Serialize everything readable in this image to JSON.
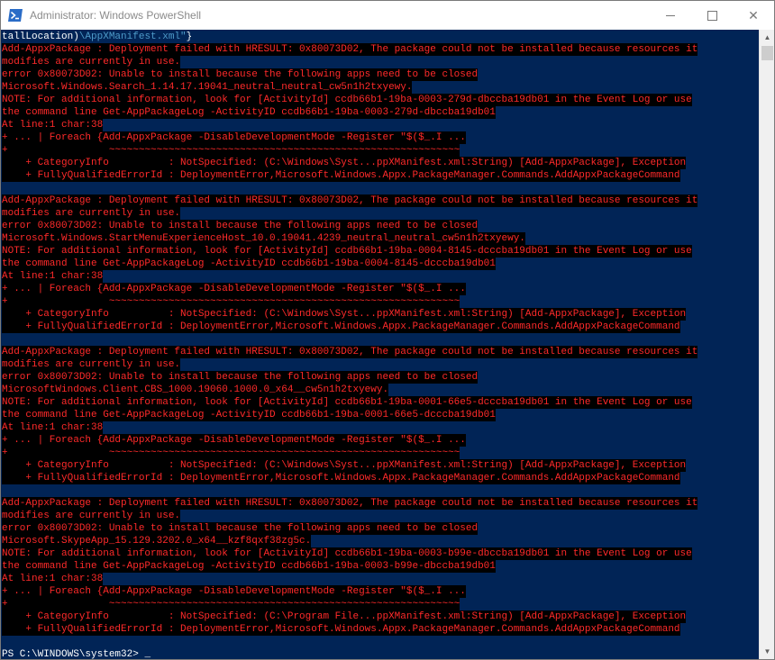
{
  "window": {
    "title": "Administrator: Windows PowerShell",
    "icon": "powershell-icon",
    "minimize_label": "",
    "maximize_label": "",
    "close_label": "✕"
  },
  "console": {
    "background": "#012456",
    "error_foreground": "#ff2a2a",
    "error_background": "#000000",
    "first_line": {
      "a": "tallLocation)",
      "b": "\\AppXManifest.xml\"",
      "c": "}"
    },
    "errors": [
      {
        "line1": "Add-AppxPackage : Deployment failed with HRESULT: 0x80073D02, The package could not be installed because resources it",
        "line2": "modifies are currently in use.",
        "line3": "error 0x80073D02: Unable to install because the following apps need to be closed",
        "line4": "Microsoft.Windows.Search_1.14.17.19041_neutral_neutral_cw5n1h2txyewy.",
        "line5": "NOTE: For additional information, look for [ActivityId] ccdb66b1-19ba-0003-279d-dbccba19db01 in the Event Log or use",
        "line6": "the command line Get-AppPackageLog -ActivityID ccdb66b1-19ba-0003-279d-dbccba19db01",
        "line7": "At line:1 char:38",
        "line8": "+ ... | Foreach {Add-AppxPackage -DisableDevelopmentMode -Register \"$($_.I ...",
        "line9": "+                 ~~~~~~~~~~~~~~~~~~~~~~~~~~~~~~~~~~~~~~~~~~~~~~~~~~~~~~~~~~~",
        "line10": "    + CategoryInfo          : NotSpecified: (C:\\Windows\\Syst...ppXManifest.xml:String) [Add-AppxPackage], Exception",
        "line11": "    + FullyQualifiedErrorId : DeploymentError,Microsoft.Windows.Appx.PackageManager.Commands.AddAppxPackageCommand"
      },
      {
        "line1": "Add-AppxPackage : Deployment failed with HRESULT: 0x80073D02, The package could not be installed because resources it",
        "line2": "modifies are currently in use.",
        "line3": "error 0x80073D02: Unable to install because the following apps need to be closed",
        "line4": "Microsoft.Windows.StartMenuExperienceHost_10.0.19041.4239_neutral_neutral_cw5n1h2txyewy.",
        "line5": "NOTE: For additional information, look for [ActivityId] ccdb66b1-19ba-0004-8145-dcccba19db01 in the Event Log or use",
        "line6": "the command line Get-AppPackageLog -ActivityID ccdb66b1-19ba-0004-8145-dcccba19db01",
        "line7": "At line:1 char:38",
        "line8": "+ ... | Foreach {Add-AppxPackage -DisableDevelopmentMode -Register \"$($_.I ...",
        "line9": "+                 ~~~~~~~~~~~~~~~~~~~~~~~~~~~~~~~~~~~~~~~~~~~~~~~~~~~~~~~~~~~",
        "line10": "    + CategoryInfo          : NotSpecified: (C:\\Windows\\Syst...ppXManifest.xml:String) [Add-AppxPackage], Exception",
        "line11": "    + FullyQualifiedErrorId : DeploymentError,Microsoft.Windows.Appx.PackageManager.Commands.AddAppxPackageCommand"
      },
      {
        "line1": "Add-AppxPackage : Deployment failed with HRESULT: 0x80073D02, The package could not be installed because resources it",
        "line2": "modifies are currently in use.",
        "line3": "error 0x80073D02: Unable to install because the following apps need to be closed",
        "line4": "MicrosoftWindows.Client.CBS_1000.19060.1000.0_x64__cw5n1h2txyewy.",
        "line5": "NOTE: For additional information, look for [ActivityId] ccdb66b1-19ba-0001-66e5-dcccba19db01 in the Event Log or use",
        "line6": "the command line Get-AppPackageLog -ActivityID ccdb66b1-19ba-0001-66e5-dcccba19db01",
        "line7": "At line:1 char:38",
        "line8": "+ ... | Foreach {Add-AppxPackage -DisableDevelopmentMode -Register \"$($_.I ...",
        "line9": "+                 ~~~~~~~~~~~~~~~~~~~~~~~~~~~~~~~~~~~~~~~~~~~~~~~~~~~~~~~~~~~",
        "line10": "    + CategoryInfo          : NotSpecified: (C:\\Windows\\Syst...ppXManifest.xml:String) [Add-AppxPackage], Exception",
        "line11": "    + FullyQualifiedErrorId : DeploymentError,Microsoft.Windows.Appx.PackageManager.Commands.AddAppxPackageCommand"
      },
      {
        "line1": "Add-AppxPackage : Deployment failed with HRESULT: 0x80073D02, The package could not be installed because resources it",
        "line2": "modifies are currently in use.",
        "line3": "error 0x80073D02: Unable to install because the following apps need to be closed",
        "line4": "Microsoft.SkypeApp_15.129.3202.0_x64__kzf8qxf38zg5c.",
        "line5": "NOTE: For additional information, look for [ActivityId] ccdb66b1-19ba-0003-b99e-dbccba19db01 in the Event Log or use",
        "line6": "the command line Get-AppPackageLog -ActivityID ccdb66b1-19ba-0003-b99e-dbccba19db01",
        "line7": "At line:1 char:38",
        "line8": "+ ... | Foreach {Add-AppxPackage -DisableDevelopmentMode -Register \"$($_.I ...",
        "line9": "+                 ~~~~~~~~~~~~~~~~~~~~~~~~~~~~~~~~~~~~~~~~~~~~~~~~~~~~~~~~~~~",
        "line10": "    + CategoryInfo          : NotSpecified: (C:\\Program File...ppXManifest.xml:String) [Add-AppxPackage], Exception",
        "line11": "    + FullyQualifiedErrorId : DeploymentError,Microsoft.Windows.Appx.PackageManager.Commands.AddAppxPackageCommand"
      }
    ],
    "prompt": "PS C:\\WINDOWS\\system32> "
  },
  "scrollbar": {
    "up_arrow": "▲",
    "down_arrow": "▼"
  }
}
